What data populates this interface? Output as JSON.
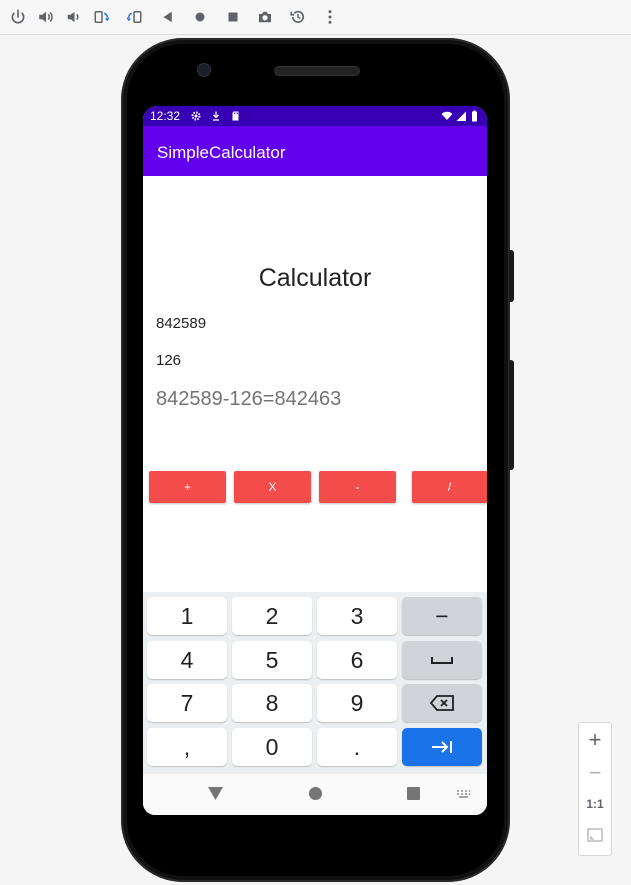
{
  "emulator_toolbar": {
    "icons": [
      "power-icon",
      "volume-up-icon",
      "volume-down-icon",
      "rotate-left-icon",
      "rotate-right-icon",
      "back-icon",
      "home-icon",
      "overview-icon",
      "camera-icon",
      "snapshot-icon",
      "more-icon"
    ]
  },
  "status_bar": {
    "time": "12:32"
  },
  "app_bar": {
    "title": "SimpleCalculator"
  },
  "calculator": {
    "heading": "Calculator",
    "first_number": "842589",
    "second_number": "126",
    "result": "842589-126=842463",
    "buttons": {
      "add": "+",
      "multiply": "X",
      "subtract": "-",
      "divide": "/"
    }
  },
  "keyboard": {
    "row1": [
      "1",
      "2",
      "3",
      "−"
    ],
    "row2": [
      "4",
      "5",
      "6",
      "␣"
    ],
    "row3": [
      "7",
      "8",
      "9"
    ],
    "row4": [
      ",",
      "0",
      "."
    ]
  },
  "zoom_panel": {
    "zoom_in": "+",
    "zoom_out": "−",
    "actual_size": "1:1"
  },
  "colors": {
    "status_bar": "#3700b3",
    "app_bar": "#6200ee",
    "operator_button": "#f44b4b",
    "keyboard_enter": "#1a73e8"
  }
}
